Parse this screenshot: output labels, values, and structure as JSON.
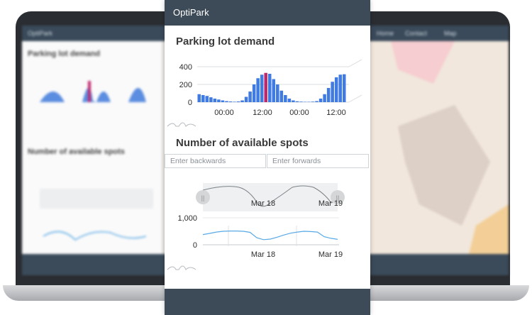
{
  "app": {
    "title": "OptiPark"
  },
  "background_laptop": {
    "title": "OptiPark",
    "nav": [
      "Home",
      "Contact",
      "Map"
    ]
  },
  "demand": {
    "title": "Parking lot demand",
    "chart_data": {
      "type": "bar",
      "y_ticks": [
        "400",
        "200",
        "0"
      ],
      "x_ticks": [
        "00:00",
        "12:00",
        "00:00",
        "12:00"
      ],
      "ylim": [
        0,
        400
      ],
      "highlight_color": "#c0286e",
      "bar_color": "#3f7be0",
      "values": [
        90,
        80,
        70,
        55,
        40,
        30,
        20,
        12,
        8,
        5,
        8,
        20,
        60,
        120,
        200,
        270,
        310,
        330,
        320,
        260,
        200,
        130,
        80,
        40,
        20,
        10,
        6,
        4,
        4,
        6,
        12,
        40,
        90,
        160,
        230,
        280,
        310,
        315
      ]
    }
  },
  "spots": {
    "title": "Number of available spots",
    "backwards_placeholder": "Enter backwards",
    "forwards_placeholder": "Enter forwards",
    "chart_data": {
      "type": "line",
      "y_ticks": [
        "1,000",
        "0"
      ],
      "x_ticks": [
        "Mar 18",
        "Mar 19"
      ],
      "ylim": [
        0,
        1000
      ],
      "line_color": "#59a9e5",
      "values": [
        380,
        420,
        470,
        500,
        510,
        510,
        500,
        460,
        260,
        190,
        210,
        280,
        360,
        430,
        470,
        500,
        490,
        470,
        300,
        240,
        200
      ],
      "navigator_x_ticks": [
        "Mar 18",
        "Mar 19"
      ]
    }
  }
}
